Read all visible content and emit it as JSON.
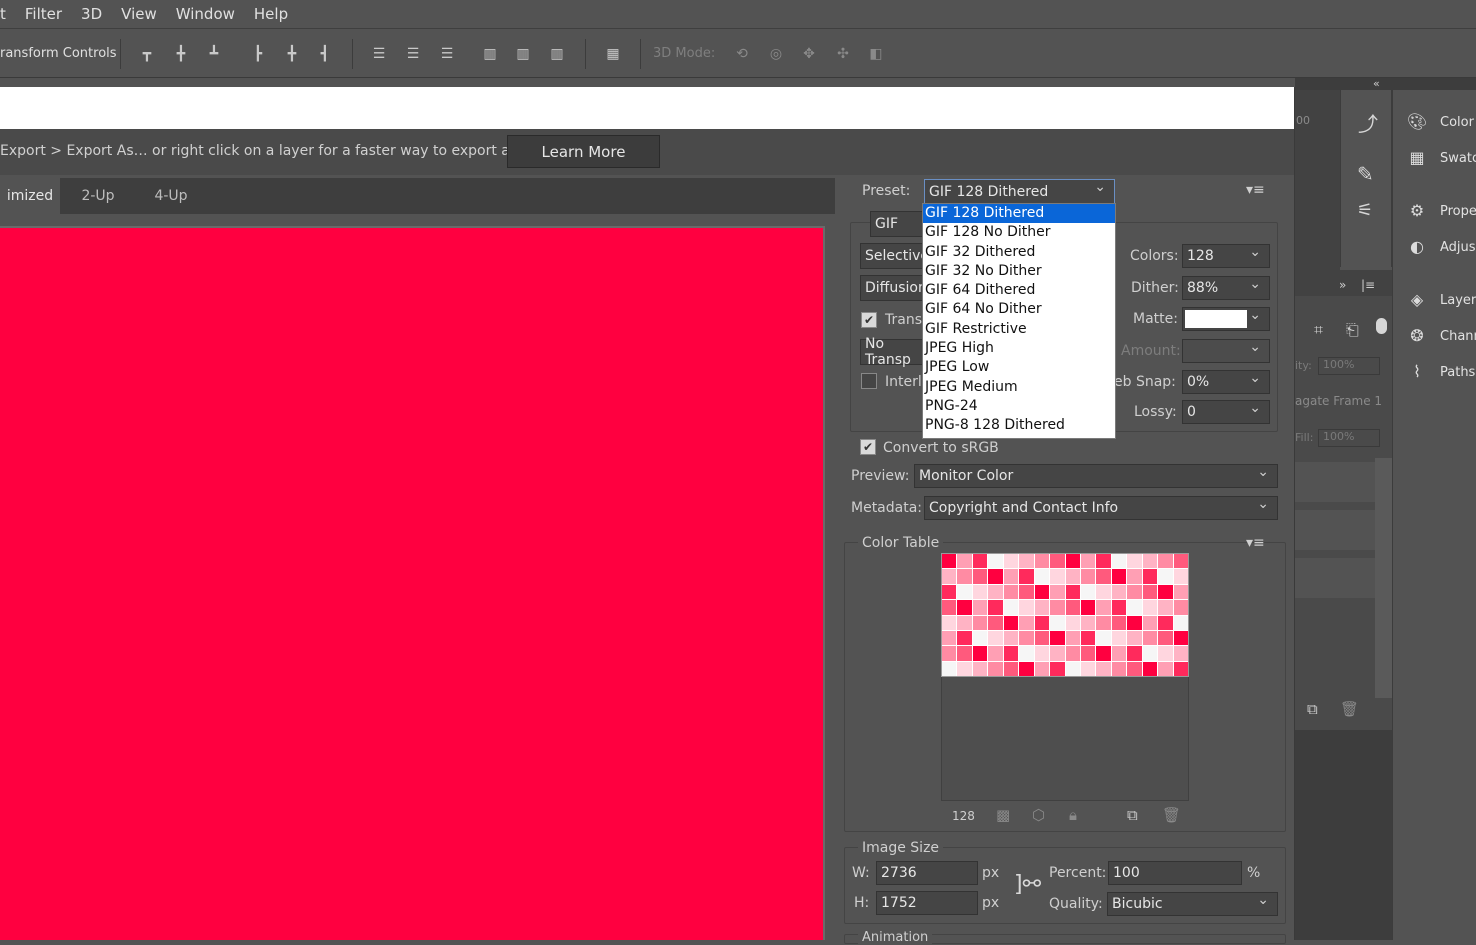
{
  "menu": [
    "t",
    "Filter",
    "3D",
    "View",
    "Window",
    "Help"
  ],
  "options_bar": {
    "transform_label": "ransform Controls",
    "mode_3d_label": "3D Mode:"
  },
  "info": {
    "hint": "Export > Export As… or right click on a layer for a faster way to export assets",
    "learn_more": "Learn More"
  },
  "tabs": [
    "imized",
    "2-Up",
    "4-Up"
  ],
  "settings": {
    "preset_label": "Preset:",
    "preset_value": "GIF 128 Dithered",
    "preset_options": [
      "GIF 128 Dithered",
      "GIF 128 No Dither",
      "GIF 32 Dithered",
      "GIF 32 No Dither",
      "GIF 64 Dithered",
      "GIF 64 No Dither",
      "GIF Restrictive",
      "JPEG High",
      "JPEG Low",
      "JPEG Medium",
      "PNG-24",
      "PNG-8 128 Dithered"
    ],
    "format": "GIF",
    "reduction": "Selective",
    "dither_algo": "Diffusion",
    "transparency": "Transp",
    "no_transparency": "No Transp",
    "interlaced": "Interla",
    "colors_label": "Colors:",
    "colors_value": "128",
    "dither_label": "Dither:",
    "dither_value": "88%",
    "matte_label": "Matte:",
    "amount_label": "Amount:",
    "websnap_label": "eb Snap:",
    "websnap_value": "0%",
    "lossy_label": "Lossy:",
    "lossy_value": "0",
    "convert_srgb": "Convert to sRGB",
    "preview_label": "Preview:",
    "preview_value": "Monitor Color",
    "metadata_label": "Metadata:",
    "metadata_value": "Copyright and Contact Info"
  },
  "color_table": {
    "title": "Color Table",
    "count": "128"
  },
  "image_size": {
    "title": "Image Size",
    "w_label": "W:",
    "w_value": "2736",
    "h_label": "H:",
    "h_value": "1752",
    "unit": "px",
    "percent_label": "Percent:",
    "percent_value": "100",
    "percent_unit": "%",
    "quality_label": "Quality:",
    "quality_value": "Bicubic"
  },
  "animation_label": "Animation",
  "right_panels": {
    "color": "Color",
    "swatches": "Swatc",
    "properties": "Prope",
    "adjustments": "Adjus",
    "layers": "Layers",
    "channels": "Chann",
    "paths": "Paths"
  },
  "layers_panel": {
    "opacity_label": "ity:",
    "opacity_value": "100%",
    "propagate": "agate Frame 1",
    "fill_label": "Fill:",
    "fill_value": "100%",
    "zoom": "00"
  },
  "colors": {
    "canvas": "#ff0040",
    "selection": "#0a66d8"
  }
}
